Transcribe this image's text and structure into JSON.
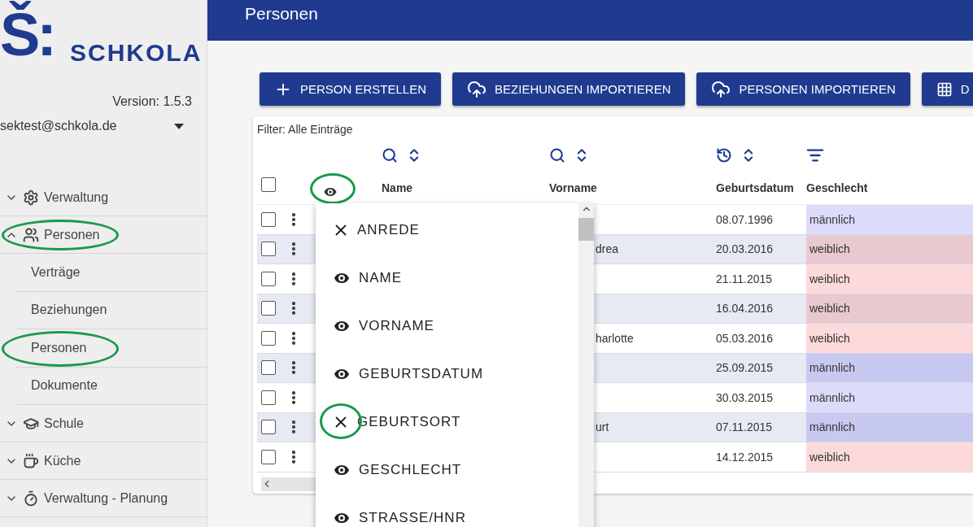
{
  "sidebar": {
    "logo": {
      "mark": "Š:",
      "name": "SCHKOLA"
    },
    "version": "Version: 1.5.3",
    "user": "sektest@schkola.de",
    "items": [
      {
        "label": "Verwaltung",
        "kind": "gear",
        "expanded": false,
        "circled": false
      },
      {
        "label": "Personen",
        "kind": "people",
        "expanded": true,
        "circled": true,
        "children": [
          {
            "label": "Verträge",
            "circled": false
          },
          {
            "label": "Beziehungen",
            "circled": false
          },
          {
            "label": "Personen",
            "circled": true
          },
          {
            "label": "Dokumente",
            "circled": false
          }
        ]
      },
      {
        "label": "Schule",
        "kind": "cap",
        "expanded": false,
        "circled": false
      },
      {
        "label": "Küche",
        "kind": "cup",
        "expanded": false,
        "circled": false
      },
      {
        "label": "Verwaltung - Planung",
        "kind": "timer",
        "expanded": false,
        "circled": false
      }
    ]
  },
  "header": {
    "title": "Personen"
  },
  "toolbar": [
    {
      "label": "PERSON ERSTELLEN",
      "kind": "plus"
    },
    {
      "label": "BEZIEHUNGEN IMPORTIEREN",
      "kind": "upload"
    },
    {
      "label": "PERSONEN IMPORTIEREN",
      "kind": "upload"
    },
    {
      "label": "D",
      "kind": "grid"
    }
  ],
  "table": {
    "filter": "Filter: Alle Einträge",
    "select_all": {
      "checked": false
    },
    "visibility_toggle": {
      "circled": true
    },
    "columns": [
      {
        "label": "Name",
        "kind": "search"
      },
      {
        "label": "Vorname",
        "kind": "search"
      },
      {
        "label": "Geburtsdatum",
        "kind": "history"
      },
      {
        "label": "Geschlecht",
        "kind": "filter"
      }
    ],
    "rows": [
      {
        "checked": false,
        "vorname": "",
        "geburtsdatum": "08.07.1996",
        "geschlecht": "männlich",
        "color": "#dcdcfa"
      },
      {
        "checked": false,
        "vorname": "drea",
        "geburtsdatum": "20.03.2016",
        "geschlecht": "weiblich",
        "color": "#e9c8cf"
      },
      {
        "checked": false,
        "vorname": "",
        "geburtsdatum": "21.11.2015",
        "geschlecht": "weiblich",
        "color": "#fcdadc"
      },
      {
        "checked": false,
        "vorname": "",
        "geburtsdatum": "16.04.2016",
        "geschlecht": "weiblich",
        "color": "#e9c8cf"
      },
      {
        "checked": false,
        "vorname": "harlotte",
        "geburtsdatum": "05.03.2016",
        "geschlecht": "weiblich",
        "color": "#fcdadc"
      },
      {
        "checked": false,
        "vorname": "",
        "geburtsdatum": "25.09.2015",
        "geschlecht": "männlich",
        "color": "#c8c9f0"
      },
      {
        "checked": false,
        "vorname": "",
        "geburtsdatum": "30.03.2015",
        "geschlecht": "männlich",
        "color": "#dcdcfa"
      },
      {
        "checked": false,
        "vorname": "urt",
        "geburtsdatum": "07.11.2015",
        "geschlecht": "männlich",
        "color": "#c8c9f0"
      },
      {
        "checked": false,
        "vorname": "",
        "geburtsdatum": "14.12.2015",
        "geschlecht": "weiblich",
        "color": "#fcdadc"
      }
    ]
  },
  "column_menu": [
    {
      "label": "ANREDE",
      "visible": false,
      "circled": false
    },
    {
      "label": "NAME",
      "visible": true,
      "circled": false
    },
    {
      "label": "VORNAME",
      "visible": true,
      "circled": false
    },
    {
      "label": "GEBURTSDATUM",
      "visible": true,
      "circled": false
    },
    {
      "label": "GEBURTSORT",
      "visible": false,
      "circled": true
    },
    {
      "label": "GESCHLECHT",
      "visible": true,
      "circled": false
    },
    {
      "label": "STRASSE/HNR",
      "visible": true,
      "circled": false
    }
  ]
}
